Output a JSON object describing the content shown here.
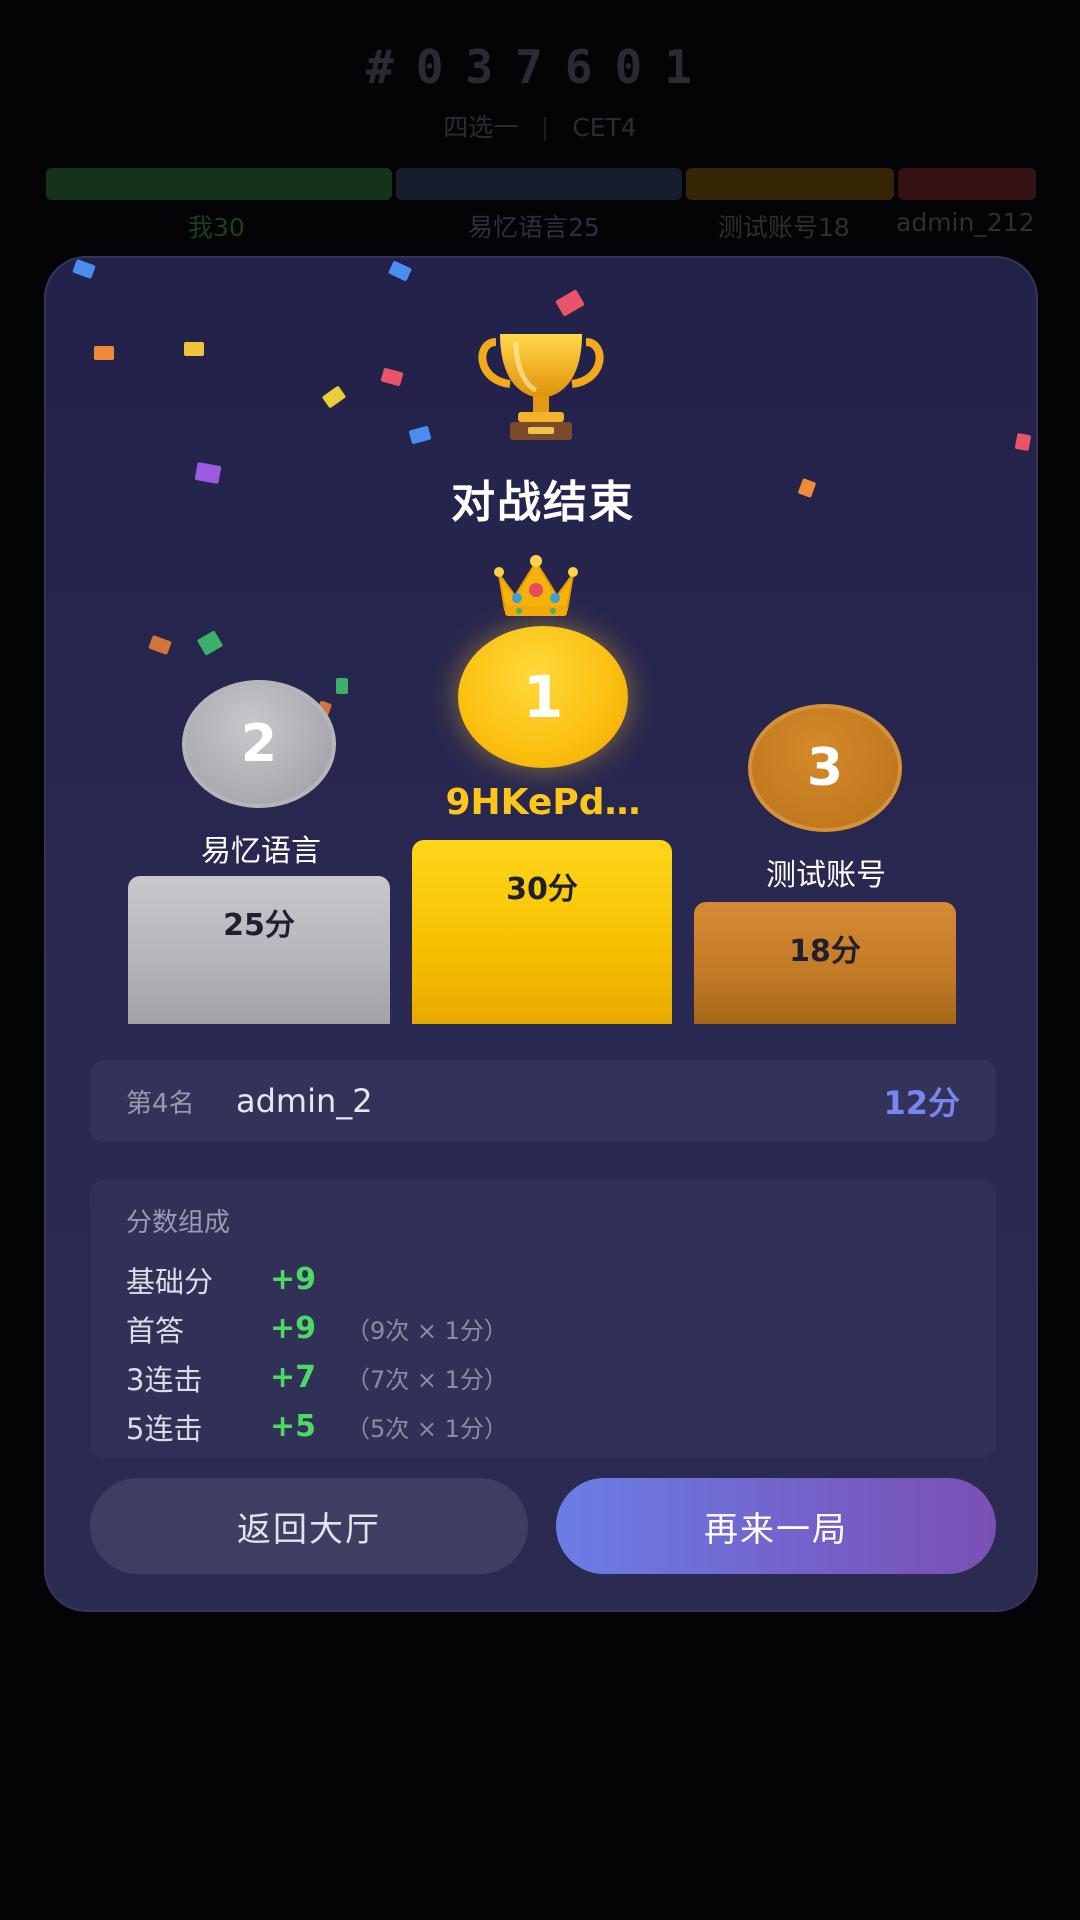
{
  "header": {
    "room_id": "#037601",
    "mode": "四选一",
    "wordbook": "CET4"
  },
  "score_bars": [
    {
      "label": "我30",
      "score": 30,
      "color": "#1a3a1c",
      "label_color": "#17421a"
    },
    {
      "label": "易忆语言25",
      "score": 25,
      "color": "#1a2233",
      "label_color": "#2c2f3c"
    },
    {
      "label": "测试账号18",
      "score": 18,
      "color": "#3c2a06",
      "label_color": "#2e2e34"
    },
    {
      "label": "admin_212",
      "score": 12,
      "color": "#3a1414",
      "label_color": "#2e2e34"
    }
  ],
  "modal": {
    "title": "对战结束",
    "trophy_icon": "trophy-icon",
    "crown_icon": "crown-icon"
  },
  "podium": {
    "first": {
      "rank": "1",
      "name": "9HKePd…",
      "score": "30分"
    },
    "second": {
      "rank": "2",
      "name": "易忆语言",
      "score": "25分"
    },
    "third": {
      "rank": "3",
      "name": "测试账号",
      "score": "18分"
    }
  },
  "rank4": {
    "label": "第4名",
    "name": "admin_2",
    "score": "12分"
  },
  "breakdown": {
    "title": "分数组成",
    "rows": [
      {
        "label": "基础分",
        "value": "+9",
        "note": ""
      },
      {
        "label": "首答",
        "value": "+9",
        "note": "（9次 × 1分）"
      },
      {
        "label": "3连击",
        "value": "+7",
        "note": "（7次 × 1分）"
      },
      {
        "label": "5连击",
        "value": "+5",
        "note": "（5次 × 1分）"
      }
    ]
  },
  "buttons": {
    "back": "返回大厅",
    "again": "再来一局"
  },
  "colors": {
    "accent_gold": "#ffc61a",
    "accent_purple": "#7460c8",
    "positive_green": "#4cd964"
  }
}
